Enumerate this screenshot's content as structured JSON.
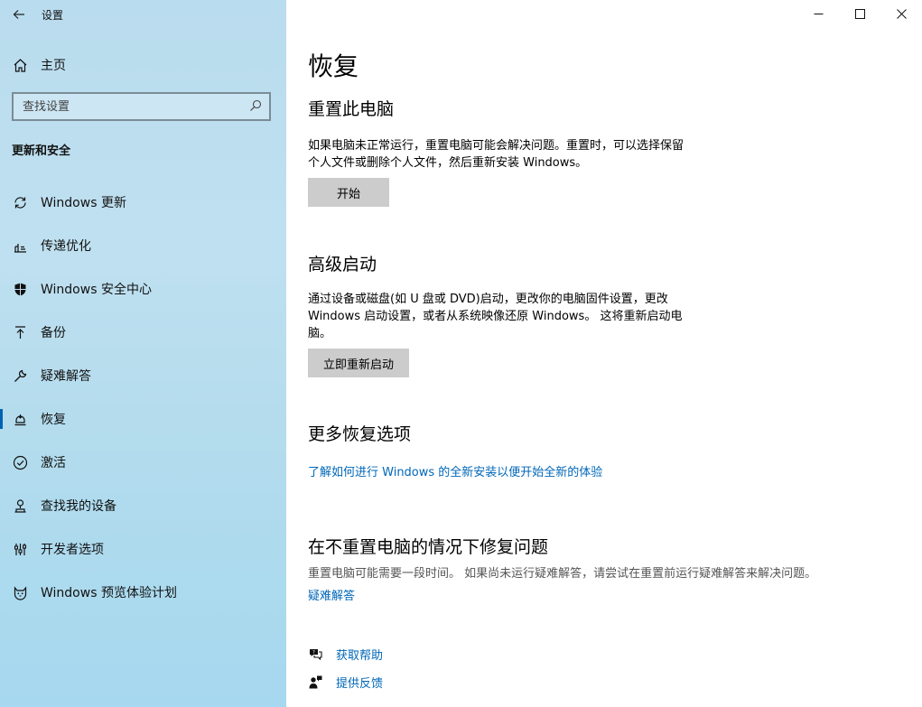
{
  "app": {
    "title": "设置"
  },
  "sidebar": {
    "home_label": "主页",
    "search_placeholder": "查找设置",
    "section_heading": "更新和安全",
    "items": [
      {
        "label": "Windows 更新",
        "icon": "refresh-icon"
      },
      {
        "label": "传递优化",
        "icon": "delivery-optimization-icon"
      },
      {
        "label": "Windows 安全中心",
        "icon": "shield-icon"
      },
      {
        "label": "备份",
        "icon": "backup-arrow-icon"
      },
      {
        "label": "疑难解答",
        "icon": "wrench-icon"
      },
      {
        "label": "恢复",
        "icon": "recovery-icon",
        "active": true
      },
      {
        "label": "激活",
        "icon": "check-circle-icon"
      },
      {
        "label": "查找我的设备",
        "icon": "find-device-icon"
      },
      {
        "label": "开发者选项",
        "icon": "developer-icon"
      },
      {
        "label": "Windows 预览体验计划",
        "icon": "insider-cat-icon"
      }
    ]
  },
  "main": {
    "title": "恢复",
    "reset": {
      "heading": "重置此电脑",
      "desc_line1": "如果电脑未正常运行，重置电脑可能会解决问题。重置时，可以选择保留",
      "desc_line2": "个人文件或删除个人文件，然后重新安装 Windows。",
      "button": "开始"
    },
    "advanced": {
      "heading": "高级启动",
      "desc_line1": "通过设备或磁盘(如 U 盘或 DVD)启动，更改你的电脑固件设置，更改",
      "desc_line2": "Windows 启动设置，或者从系统映像还原 Windows。 这将重新启动电",
      "desc_line3": "脑。",
      "button": "立即重新启动"
    },
    "more": {
      "heading": "更多恢复选项",
      "link": "了解如何进行 Windows 的全新安装以便开始全新的体验"
    },
    "fix": {
      "heading": "在不重置电脑的情况下修复问题",
      "desc": "重置电脑可能需要一段时间。 如果尚未运行疑难解答，请尝试在重置前运行疑难解答来解决问题。",
      "link": "疑难解答"
    },
    "help": {
      "get_help": "获取帮助",
      "feedback": "提供反馈"
    }
  },
  "colors": {
    "accent": "#0067b8",
    "button_bg": "#cccccc",
    "sidebar_bg": "#bfe0f0"
  }
}
